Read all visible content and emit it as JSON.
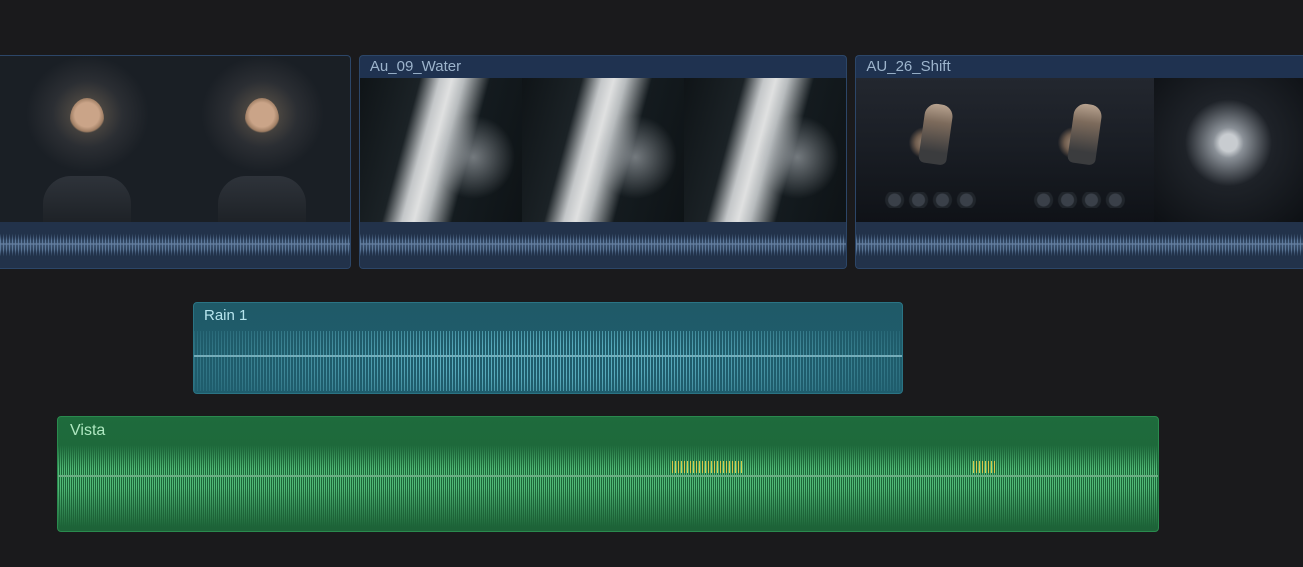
{
  "videoTrack": {
    "clips": [
      {
        "title": "",
        "widthPx": 352,
        "showTitle": false,
        "thumbStyle": "interview",
        "thumbCount": 2,
        "markers": [
          {
            "color": "green",
            "leftPx": 55
          },
          {
            "color": "cyan",
            "leftPx": 265
          }
        ]
      },
      {
        "title": "Au_09_Water",
        "widthPx": 490,
        "showTitle": true,
        "thumbStyle": "water",
        "thumbCount": 3,
        "markers": []
      },
      {
        "title": "AU_26_Shift",
        "widthPx": 449,
        "showTitle": true,
        "thumbStyle": "shift",
        "thumbCount": 3,
        "lastThumbStyle": "knob",
        "markers": []
      }
    ]
  },
  "audioClips": {
    "rain": {
      "title": "Rain 1",
      "leftPx": 193,
      "widthPx": 708,
      "color": "#1f5a68"
    },
    "vista": {
      "title": "Vista",
      "leftPx": 57,
      "widthPx": 1100,
      "color": "#1e6b3c",
      "peaks": [
        {
          "leftPx": 614,
          "widthPx": 70
        },
        {
          "leftPx": 915,
          "widthPx": 24
        }
      ]
    }
  }
}
